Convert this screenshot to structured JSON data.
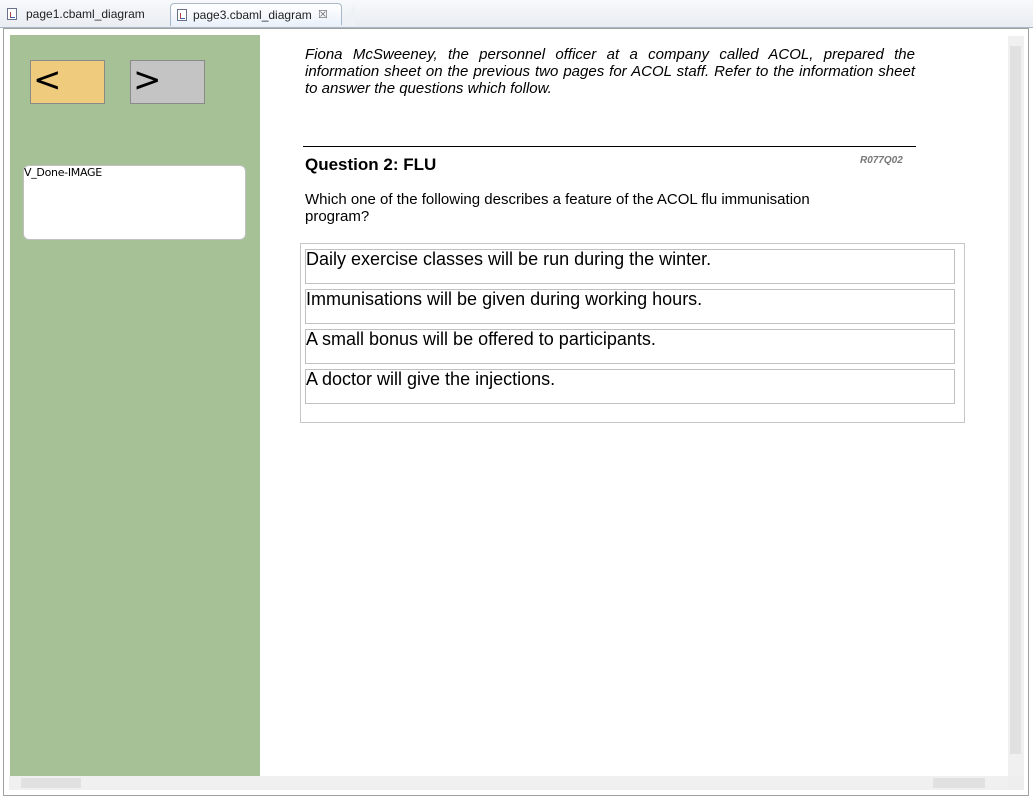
{
  "tabs": [
    {
      "label": "page1.cbaml_diagram",
      "active": false
    },
    {
      "label": "page3.cbaml_diagram",
      "active": true,
      "close": "☒"
    }
  ],
  "nav": {
    "prev_label": "<",
    "next_label": ">",
    "prev_color": "#efcb7d",
    "next_color": "#c4c4c4"
  },
  "done_image": {
    "label": "V_Done-IMAGE"
  },
  "panel_color": "#a6c196",
  "content": {
    "intro": "Fiona McSweeney, the personnel officer at a company called ACOL, prepared the information sheet on the previous two pages for ACOL staff. Refer to the information sheet to answer the questions which follow.",
    "question_title": "Question 2: FLU",
    "question_code": "R077Q02",
    "question_text": "Which one of the following describes a feature of the ACOL flu immunisation program?",
    "options": [
      "Daily exercise classes will be run during the winter.",
      "Immunisations will be given during working hours.",
      "A small bonus will be offered to participants.",
      "A doctor will give the injections."
    ]
  }
}
